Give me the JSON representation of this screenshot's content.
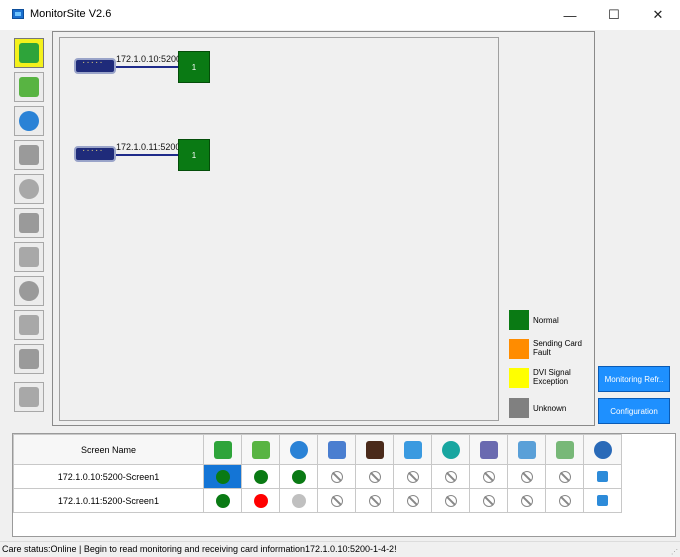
{
  "window": {
    "title": "MonitorSite V2.6"
  },
  "toolbar": {
    "items": [
      {
        "name": "sending-card",
        "color": "#2ea43a"
      },
      {
        "name": "receiving-card",
        "color": "#58b442"
      },
      {
        "name": "temperature",
        "color": "#2a82d6"
      },
      {
        "name": "humidity-disabled",
        "color": "#9a9a9a"
      },
      {
        "name": "smoke-disabled",
        "color": "#a8a8a8"
      },
      {
        "name": "fire-disabled",
        "color": "#9a9a9a"
      },
      {
        "name": "fan-disabled",
        "color": "#a8a8a8"
      },
      {
        "name": "voltage-disabled",
        "color": "#9a9a9a"
      },
      {
        "name": "magnet-disabled",
        "color": "#a8a8a8"
      },
      {
        "name": "door-disabled",
        "color": "#9a9a9a"
      },
      {
        "name": "module-disabled",
        "color": "#a8a8a8"
      }
    ]
  },
  "topology": {
    "links": [
      {
        "ip": "172.1.0.10:5200",
        "node": "1"
      },
      {
        "ip": "172.1.0.11:5200",
        "node": "1"
      }
    ]
  },
  "legend": {
    "items": [
      {
        "label": "Normal",
        "color": "#0a7a14"
      },
      {
        "label": "Sending Card Fault",
        "color": "#ff8c00"
      },
      {
        "label": "DVI Signal Exception",
        "color": "#ffff00"
      },
      {
        "label": "Unknown",
        "color": "#808080"
      }
    ]
  },
  "actions": {
    "monitoring_refresh": "Monitoring Refr..",
    "configuration": "Configuration"
  },
  "grid": {
    "header": {
      "screen_name": "Screen Name"
    },
    "rows": [
      {
        "name": "172.1.0.10:5200-Screen1",
        "status": [
          "green",
          "green",
          "green",
          "na",
          "na",
          "na",
          "na",
          "na",
          "na",
          "na",
          "refresh"
        ]
      },
      {
        "name": "172.1.0.11:5200-Screen1",
        "status": [
          "green",
          "red",
          "gray",
          "na",
          "na",
          "na",
          "na",
          "na",
          "na",
          "na",
          "refresh"
        ]
      }
    ]
  },
  "statusbar": {
    "text": "Care status:Online  |  Begin to read monitoring and receiving card information172.1.0.10:5200-1-4-2!"
  },
  "colors": {
    "accent": "#1e90ff",
    "green": "#0a7a14",
    "red": "#ff0000",
    "gray": "#c0c0c0"
  }
}
